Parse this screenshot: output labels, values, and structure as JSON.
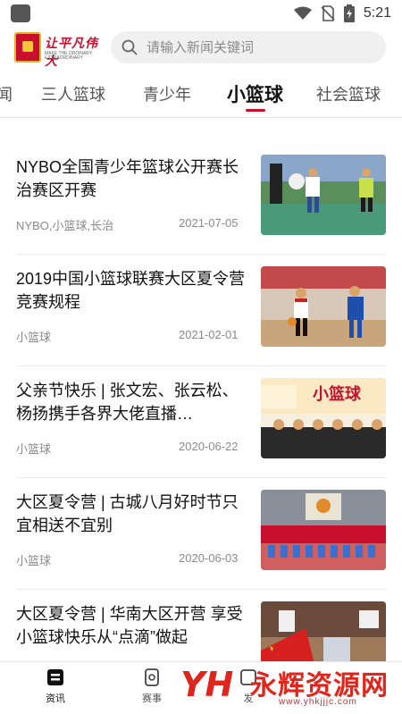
{
  "status_bar": {
    "time": "5:21",
    "icons": [
      "wifi-icon",
      "no-sim-icon",
      "battery-charging-icon"
    ]
  },
  "header": {
    "logo_text": "让平凡伟大",
    "logo_subtext": "MAKE THE ORDINARY EXTRAORDINARY",
    "search_placeholder": "请输入新闻关键词"
  },
  "tabs": [
    {
      "label": "闻",
      "active": false
    },
    {
      "label": "三人篮球",
      "active": false
    },
    {
      "label": "青少年",
      "active": false
    },
    {
      "label": "小篮球",
      "active": true
    },
    {
      "label": "社会篮球",
      "active": false
    }
  ],
  "articles": [
    {
      "title": "NYBO全国青少年篮球公开赛长治赛区开赛",
      "tags": "NYBO,小篮球,长治",
      "date": "2021-07-05"
    },
    {
      "title": "2019中国小篮球联赛大区夏令营竞赛规程",
      "tags": "小篮球",
      "date": "2021-02-01"
    },
    {
      "title": "父亲节快乐 | 张文宏、张云松、杨扬携手各界大佬直播…",
      "tags": "小篮球",
      "date": "2020-06-22",
      "thumb_text": "小篮球"
    },
    {
      "title": "大区夏令营 | 古城八月好时节只宜相送不宜别",
      "tags": "小篮球",
      "date": "2020-06-03"
    },
    {
      "title": "大区夏令营 | 华南大区开营 享受小篮球快乐从“点滴”做起",
      "tags": "",
      "date": ""
    }
  ],
  "bottom_nav": [
    {
      "label": "资讯",
      "icon": "news-icon",
      "active": true
    },
    {
      "label": "赛事",
      "icon": "match-icon",
      "active": false
    },
    {
      "label": "发",
      "icon": "publish-icon",
      "active": false
    }
  ],
  "watermark": {
    "logo": "YH",
    "text": "永辉资源网",
    "url": "www.yhkjjjc.com"
  },
  "colors": {
    "brand_red": "#c8102e",
    "text_primary": "#111111",
    "text_secondary": "#8a8a8a",
    "search_bg": "#f0f0f0"
  }
}
